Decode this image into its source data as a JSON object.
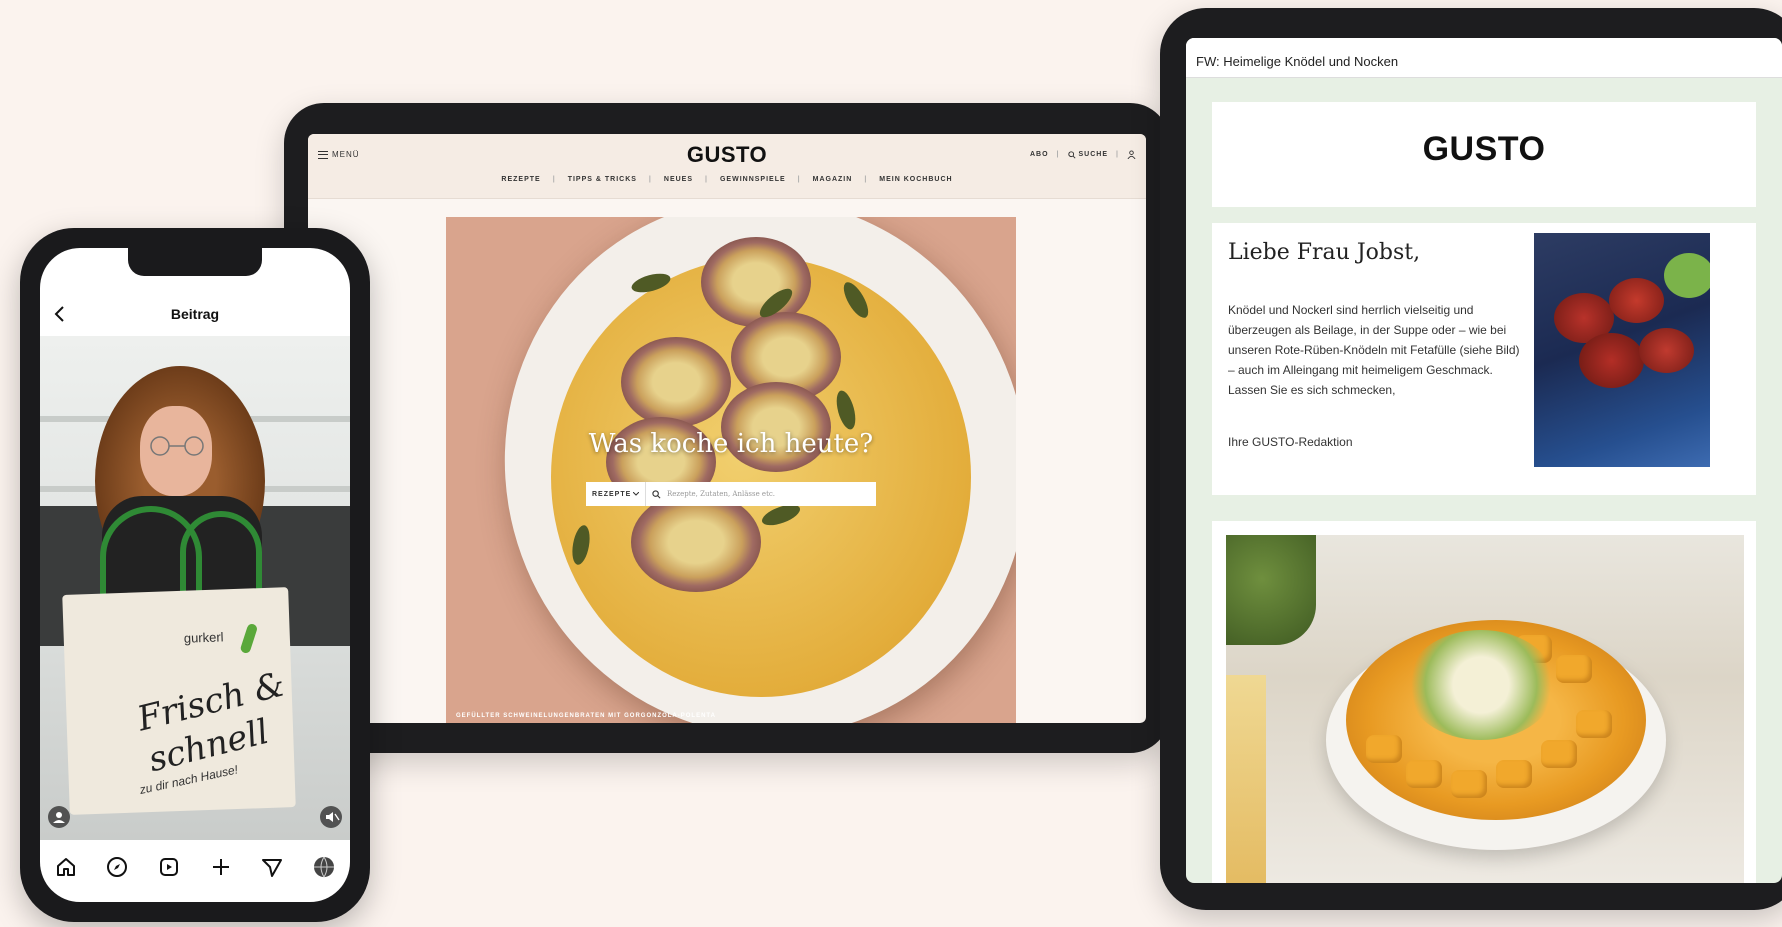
{
  "website": {
    "menu_label": "MENÜ",
    "logo": "GUSTO",
    "nav": [
      "REZEPTE",
      "TIPPS & TRICKS",
      "NEUES",
      "GEWINNSPIELE",
      "MAGAZIN",
      "MEIN KOCHBUCH"
    ],
    "abo_label": "ABO",
    "search_label": "SUCHE",
    "hero_title": "Was koche ich heute?",
    "search_category": "REZEPTE",
    "search_placeholder": "Rezepte, Zutaten, Anlässe etc.",
    "hero_caption": "GEFÜLLTER SCHWEINELUNGENBRATEN MIT GORGONZOLA-POLENTA"
  },
  "email": {
    "subject": "FW: Heimelige Knödel und Nocken",
    "logo": "GUSTO",
    "greeting": "Liebe Frau Jobst,",
    "body": "Knödel und Nockerl sind herrlich vielseitig und überzeugen als Beilage, in der Suppe oder – wie bei unseren Rote-Rüben-Knödeln mit Fetafülle (siehe Bild) – auch im Alleingang mit heimeligem Geschmack. Lassen Sie es sich schmecken,",
    "signature": "Ihre GUSTO-Redaktion"
  },
  "phone": {
    "title": "Beitrag",
    "bag_brand": "gurkerl",
    "bag_line1": "Frisch &",
    "bag_line2": "schnell",
    "bag_line3": "zu dir nach Hause!",
    "tab_icons": [
      "home-icon",
      "compass-icon",
      "reels-icon",
      "plus-icon",
      "send-icon",
      "profile-globe-icon"
    ]
  },
  "colors": {
    "page_bg": "#fbf3ee",
    "device_frame": "#1d1d1f",
    "email_bg": "#e7f0e4",
    "bag_handle": "#2f8a35"
  }
}
